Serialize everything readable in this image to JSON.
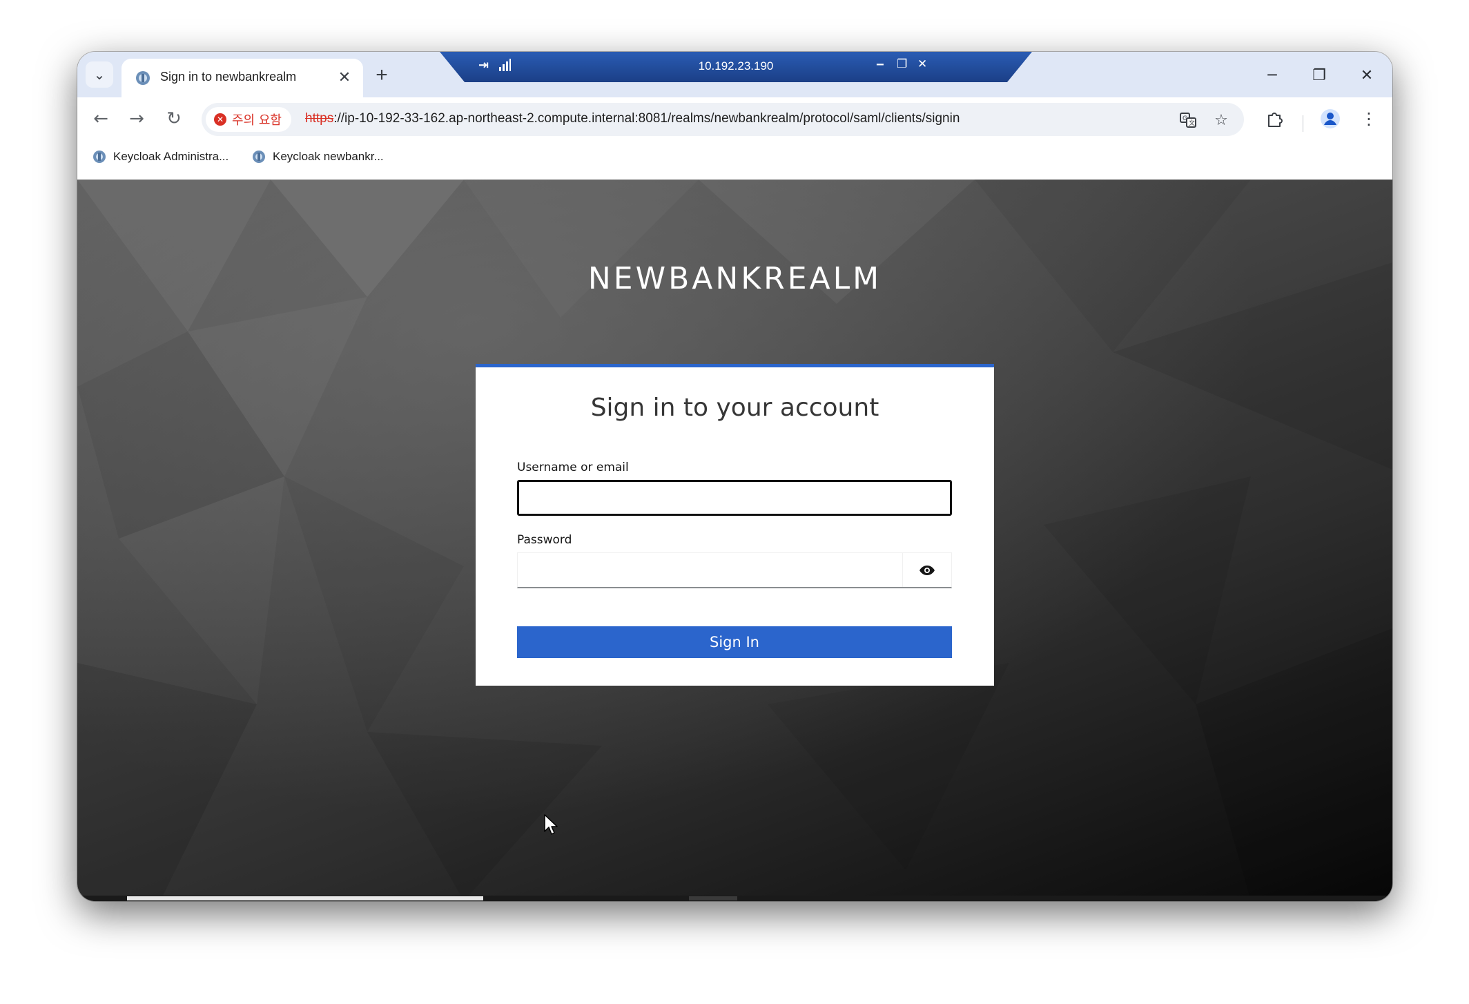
{
  "browser": {
    "tab": {
      "title": "Sign in to newbankrealm",
      "close_glyph": "✕"
    },
    "new_tab_glyph": "+",
    "tab_search_glyph": "⌄",
    "window_controls": {
      "minimize": "─",
      "restore": "❐",
      "close": "✕"
    },
    "remote_bar": {
      "host": "10.192.23.190",
      "pin_glyph": "⇥",
      "minimize": "‒",
      "restore": "❐",
      "close": "✕"
    },
    "toolbar": {
      "back_glyph": "←",
      "forward_glyph": "→",
      "reload_glyph": "↻",
      "security_icon_glyph": "✕",
      "security_label": "주의 요함",
      "url_scheme": "https",
      "url_rest": "://ip-10-192-33-162.ap-northeast-2.compute.internal:8081/realms/newbankrealm/protocol/saml/clients/signin",
      "bookmark_glyph": "☆",
      "menu_glyph": "⋮"
    },
    "bookmarks": [
      {
        "label": "Keycloak Administra..."
      },
      {
        "label": "Keycloak newbankr..."
      }
    ]
  },
  "login": {
    "realm_name": "NEWBANKREALM",
    "heading": "Sign in to your account",
    "username_label": "Username or email",
    "username_value": "",
    "password_label": "Password",
    "password_value": "",
    "submit_label": "Sign In"
  },
  "colors": {
    "accent": "#2b65cc",
    "warning": "#d93025",
    "remote_bar": "#1b3f86"
  }
}
